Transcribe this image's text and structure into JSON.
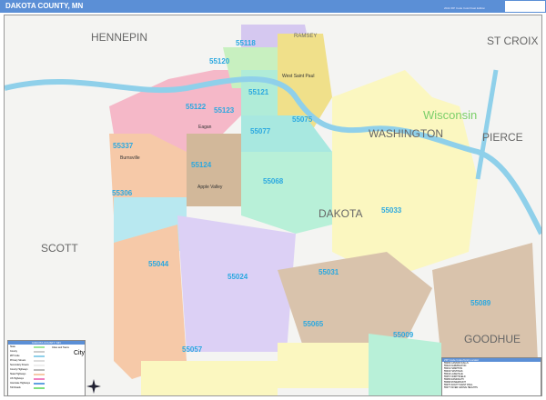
{
  "header": {
    "title": "DAKOTA COUNTY, MN",
    "subtitle": "2022 ZIP Code Color/Cast Edition"
  },
  "map": {
    "counties": [
      {
        "name": "HENNEPIN"
      },
      {
        "name": "RAMSEY"
      },
      {
        "name": "ST CROIX"
      },
      {
        "name": "WASHINGTON"
      },
      {
        "name": "PIERCE"
      },
      {
        "name": "DAKOTA"
      },
      {
        "name": "SCOTT"
      },
      {
        "name": "GOODHUE"
      }
    ],
    "state_label": "Wisconsin",
    "zips": [
      "55118",
      "55120",
      "55121",
      "55122",
      "55123",
      "55075",
      "55077",
      "55337",
      "55124",
      "55306",
      "55068",
      "55033",
      "55044",
      "55024",
      "55031",
      "55089",
      "55065",
      "55057",
      "55009"
    ],
    "cities": [
      "Eagan",
      "Burnsville",
      "Apple Valley",
      "West Saint Paul"
    ]
  },
  "legend": {
    "title": "DAKOTA COUNTY, MN",
    "items": [
      "State",
      "County",
      "ZIP Code",
      "Primary Streets",
      "Secondary Streets",
      "County Highways",
      "State Highways",
      "US Highways",
      "Interstate Highways",
      "Toll Roads"
    ],
    "cities_title": "Cities and Towns",
    "city_sample": "City"
  },
  "index": {
    "title": "ZIP Code Index/Grid Locator",
    "rows": [
      "55009 CANNON FALLS",
      "55024 FARMINGTON",
      "55031 HAMPTON",
      "55033 HASTINGS",
      "55044 LAKEVILLE",
      "55057 NORTHFIELD",
      "55065 RANDOLPH",
      "55068 ROSEMOUNT",
      "55075 SOUTH SAINT PAUL",
      "55077 INVER GROVE HEIGHTS"
    ]
  },
  "colors": {
    "header": "#5b8fd6",
    "water": "#8fd0ea"
  }
}
